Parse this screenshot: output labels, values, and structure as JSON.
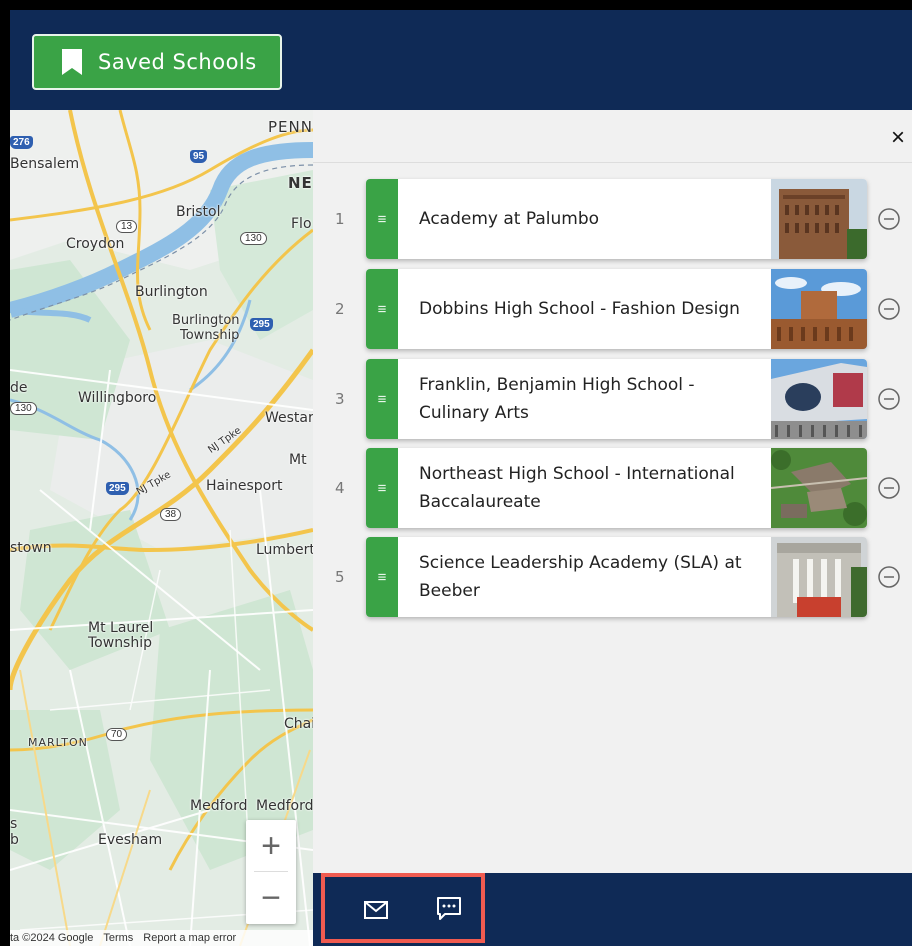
{
  "header": {
    "saved_button_label": "Saved Schools"
  },
  "map": {
    "labels": {
      "bensalem": "Bensalem",
      "penn": "PENN",
      "ne": "NE",
      "bristol": "Bristol",
      "flo": "Flo",
      "croydon": "Croydon",
      "burlington": "Burlington",
      "burlington_twp_1": "Burlington",
      "burlington_twp_2": "Township",
      "willingboro": "Willingboro",
      "westar": "Westar",
      "de": "de",
      "nj_tpke_1": "NJ Tpke",
      "nj_tpke_2": "NJ Tpke",
      "mt": "Mt",
      "hainesport": "Hainesport",
      "stown": "stown",
      "lumbert": "Lumbert",
      "mt_laurel_1": "Mt Laurel",
      "mt_laurel_2": "Township",
      "chai": "Chai",
      "marlton": "MARLTON",
      "medford": "Medford",
      "medford2": "Medford",
      "evesham": "Evesham",
      "s": "s",
      "b": "b"
    },
    "shields": {
      "i276": "276",
      "i95": "95",
      "r13": "13",
      "r130a": "130",
      "i295a": "295",
      "r130b": "130",
      "i295b": "295",
      "r38": "38",
      "r70": "70"
    },
    "zoom_in": "+",
    "zoom_out": "−",
    "attribution": {
      "data": "ta ©2024 Google",
      "terms": "Terms",
      "report": "Report a map error"
    }
  },
  "panel": {
    "close_label": "×",
    "schools": [
      {
        "rank": "1",
        "name": "Academy at Palumbo"
      },
      {
        "rank": "2",
        "name": "Dobbins High School - Fashion Design"
      },
      {
        "rank": "3",
        "name": "Franklin, Benjamin High School - Culinary Arts"
      },
      {
        "rank": "4",
        "name": "Northeast High School - International Baccalaureate"
      },
      {
        "rank": "5",
        "name": "Science Leadership Academy (SLA) at Beeber"
      }
    ],
    "handle_glyph": "≡"
  },
  "colors": {
    "navy": "#0f2a56",
    "green": "#3aa346",
    "highlight": "#f05b50"
  }
}
